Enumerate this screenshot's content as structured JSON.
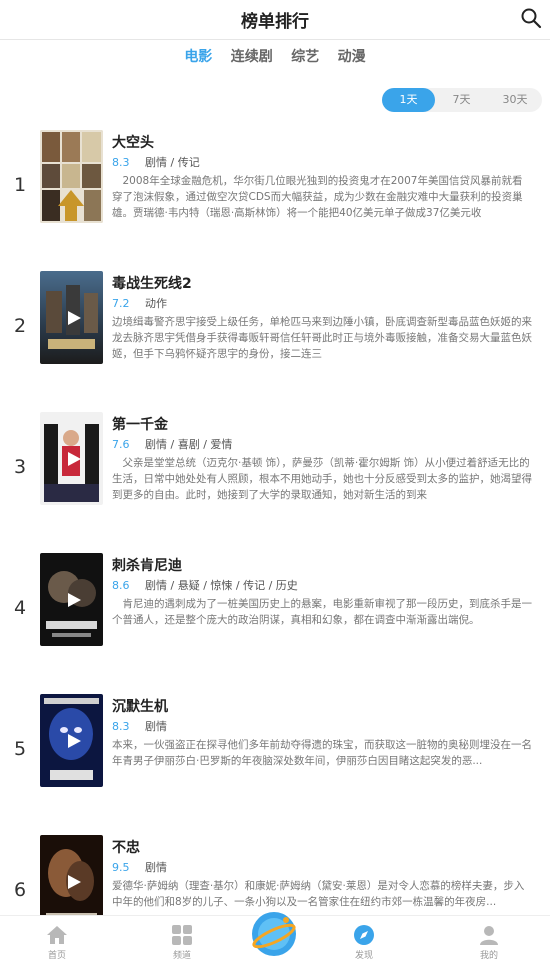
{
  "header": {
    "title": "榜单排行",
    "search_icon": "search-icon"
  },
  "tabs": [
    {
      "label": "电影",
      "active": true
    },
    {
      "label": "连续剧",
      "active": false
    },
    {
      "label": "综艺",
      "active": false
    },
    {
      "label": "动漫",
      "active": false
    }
  ],
  "range": [
    {
      "label": "1天",
      "active": true
    },
    {
      "label": "7天",
      "active": false
    },
    {
      "label": "30天",
      "active": false
    }
  ],
  "items": [
    {
      "rank": "1",
      "title": "大空头",
      "score": "8.3",
      "genres": "剧情 / 传记",
      "desc": "　2008年全球金融危机，华尔街几位眼光独到的投资鬼才在2007年美国信贷风暴前就看穿了泡沫假象，通过做空次贷CDS而大幅获益，成为少数在金融灾难中大量获利的投资巢雄。贾瑞德·韦内特（瑞恩·高斯林饰）将一个能把40亿美元单子做成37亿美元收",
      "has_play": false
    },
    {
      "rank": "2",
      "title": "毒战生死线2",
      "score": "7.2",
      "genres": "动作",
      "desc": "边境缉毒警齐思宇接受上级任务，单枪匹马来到边陲小镇，卧底调查新型毒品蓝色妖姬的来龙去脉齐思宇凭借身手获得毒贩轩哥信任轩哥此时正与境外毒贩接触，准备交易大量蓝色妖姬，但手下乌鸦怀疑齐思宇的身份，接二连三",
      "has_play": true
    },
    {
      "rank": "3",
      "title": "第一千金",
      "score": "7.6",
      "genres": "剧情 / 喜剧 / 爱情",
      "desc": "　父亲是堂堂总统（迈克尔·基顿 饰），萨曼莎（凯蒂·霍尔姆斯 饰）从小便过着舒适无比的生活，日常中她处处有人照顾，根本不用她动手，她也十分反感受到太多的监护，她渴望得到更多的自由。此时，她接到了大学的录取通知，她对新生活的到来",
      "has_play": true
    },
    {
      "rank": "4",
      "title": "刺杀肯尼迪",
      "score": "8.6",
      "genres": "剧情 / 悬疑 / 惊悚 / 传记 / 历史",
      "desc": "　肯尼迪的遇刺成为了一桩美国历史上的悬案，电影重新审视了那一段历史，到底杀手是一个普通人，还是整个庞大的政治阴谋，真相和幻象，都在调查中渐渐露出端倪。",
      "has_play": true
    },
    {
      "rank": "5",
      "title": "沉默生机",
      "score": "8.3",
      "genres": "剧情",
      "desc": "本来，一伙强盗正在探寻他们多年前劫夺得遗的珠宝，而获取这一脏物的奥秘则埋没在一名年青男子伊丽莎白·巴罗斯的年夜脑深处数年间，伊丽莎白因目睹这起突发的恶...",
      "has_play": true
    },
    {
      "rank": "6",
      "title": "不忠",
      "score": "9.5",
      "genres": "剧情",
      "desc": "爱德华·萨姆纳（理查·基尔）和康妮·萨姆纳（黛安·莱恩）是对令人恋慕的榜样夫妻，步入中年的他们和8岁的儿子、一条小狗以及一名管家住在纽约市郊一栋温馨的年夜房...",
      "has_play": true
    }
  ],
  "bottom_nav": [
    {
      "label": "首页",
      "icon": "home-icon"
    },
    {
      "label": "频道",
      "icon": "grid-icon"
    },
    {
      "label": "发现",
      "icon": "compass-icon"
    },
    {
      "label": "我的",
      "icon": "user-icon"
    }
  ],
  "colors": {
    "accent": "#3aa4ea",
    "text": "#222222",
    "muted": "#777777"
  }
}
